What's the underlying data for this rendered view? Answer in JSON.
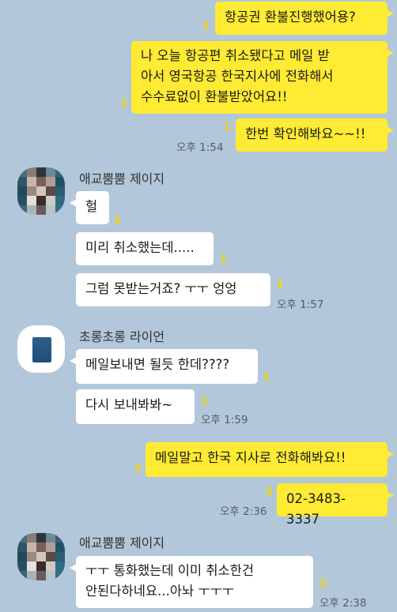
{
  "messages": {
    "m1": {
      "text": "항공권 환불진행했어용?",
      "unread": "1"
    },
    "m2": {
      "text": "나 오늘 항공편 취소됐다고 메일 받\n아서 영국항공 한국지사에 전화해서\n수수료없이 환불받았어요!!",
      "unread": "1"
    },
    "m3": {
      "text": "한번 확인해봐요~~!!",
      "unread": "1",
      "time": "오후 1:54"
    },
    "jeji1": {
      "name": "애교뿜뿜 제이지",
      "b1": {
        "text": "헐",
        "unread": "1"
      },
      "b2": {
        "text": "미리 취소했는데.....",
        "unread": "1"
      },
      "b3": {
        "text": "그럼 못받는거죠? ㅜㅜ 엉엉",
        "unread": "1",
        "time": "오후 1:57"
      }
    },
    "ryan": {
      "name": "초롱초롱 라이언",
      "b1": {
        "text": "메일보내면 될듯 한데????",
        "unread": "1"
      },
      "b2": {
        "text": "다시 보내봐봐~",
        "unread": "1",
        "time": "오후 1:59"
      }
    },
    "m4": {
      "text": "메일말고 한국 지사로 전화해봐요!!",
      "unread": "2"
    },
    "m5": {
      "text": "02-3483-3337",
      "unread": "2",
      "time": "오후 2:36"
    },
    "jeji2": {
      "name": "애교뿜뿜 제이지",
      "b1": {
        "text": "ㅜㅜ 통화했는데 이미 취소한건\n안된다하네요...아놔 ㅜㅜㅜ",
        "unread": "2",
        "time": "오후 2:38"
      }
    }
  },
  "colors": {
    "background": "#b2c7d9",
    "my_bubble": "#ffeb33",
    "their_bubble": "#ffffff",
    "unread_count": "#f5d400"
  }
}
